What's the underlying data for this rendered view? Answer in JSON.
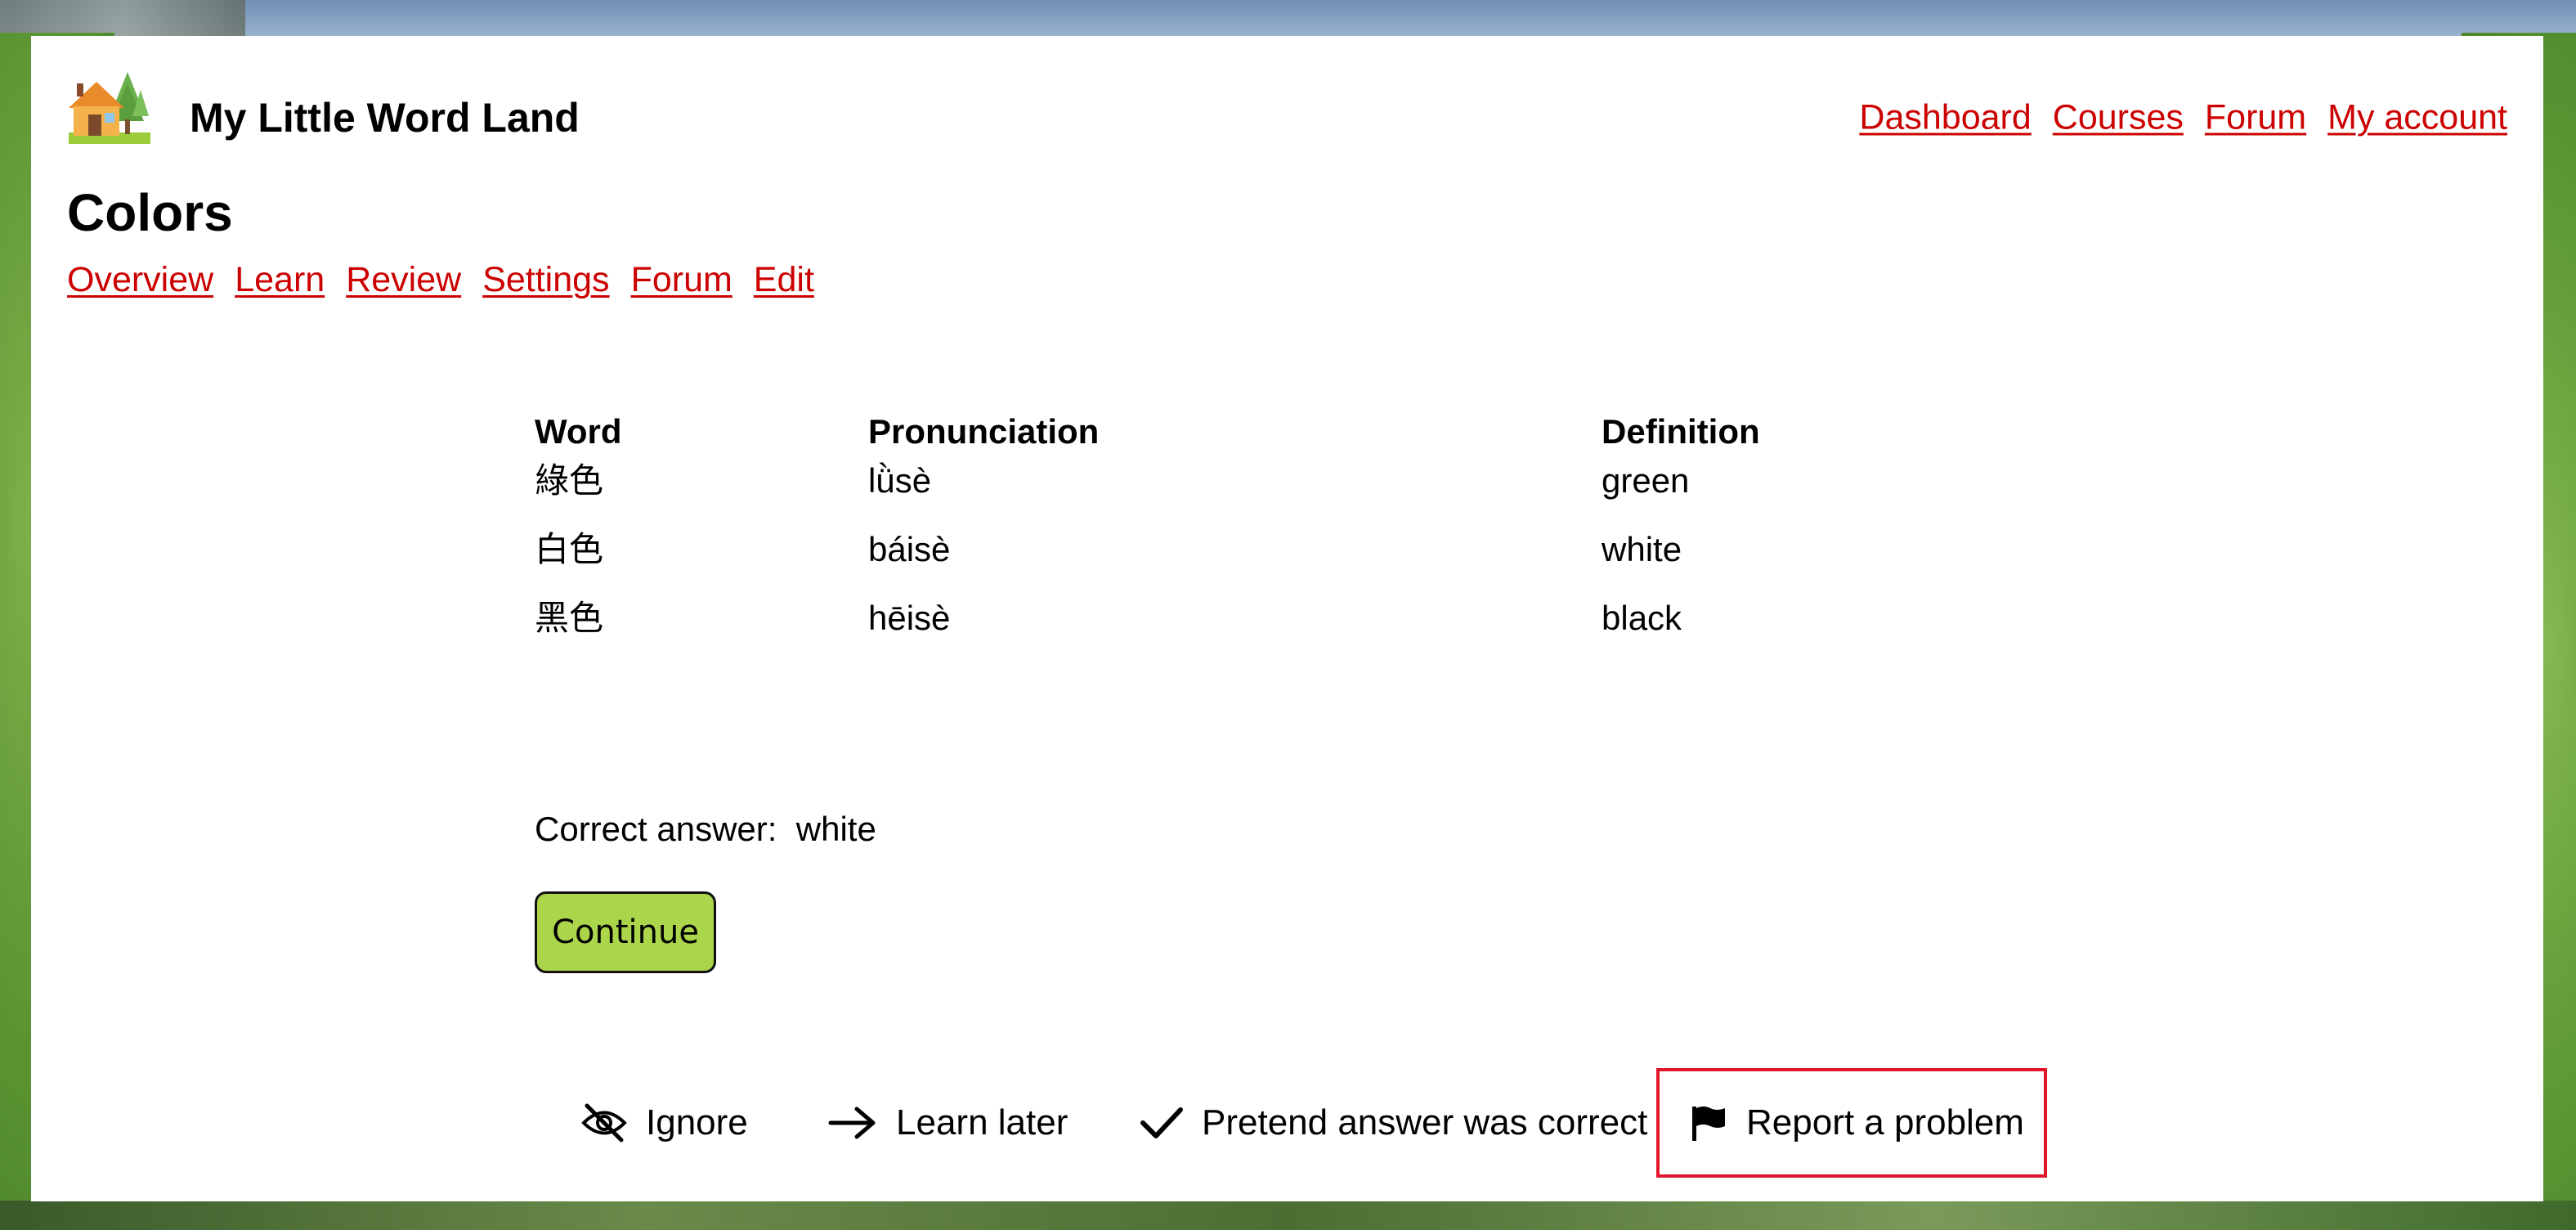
{
  "site": {
    "title": "My Little Word Land",
    "logo_icon": "house-with-trees-icon"
  },
  "top_nav": {
    "items": [
      "Dashboard",
      "Courses",
      "Forum",
      "My account"
    ]
  },
  "page": {
    "title": "Colors"
  },
  "sub_nav": {
    "items": [
      "Overview",
      "Learn",
      "Review",
      "Settings",
      "Forum",
      "Edit"
    ]
  },
  "words_table": {
    "headers": [
      "Word",
      "Pronunciation",
      "Definition"
    ],
    "rows": [
      [
        "綠色",
        "lǜsè",
        "green"
      ],
      [
        "白色",
        "báisè",
        "white"
      ],
      [
        "黑色",
        "hēisè",
        "black"
      ]
    ]
  },
  "result": {
    "label": "Correct answer:",
    "value": "white"
  },
  "continue_button": {
    "label": "Continue"
  },
  "actions": {
    "ignore": {
      "label": "Ignore",
      "icon": "eye-slash-icon"
    },
    "learn_later": {
      "label": "Learn later",
      "icon": "arrow-right-icon"
    },
    "pretend_correct": {
      "label": "Pretend answer was correct",
      "icon": "checkmark-icon"
    },
    "report": {
      "label": "Report a problem",
      "icon": "flag-icon"
    }
  },
  "colors": {
    "link": "#cc0000",
    "continue_button_bg": "#abd54a",
    "report_highlight_border": "#e0162b"
  }
}
